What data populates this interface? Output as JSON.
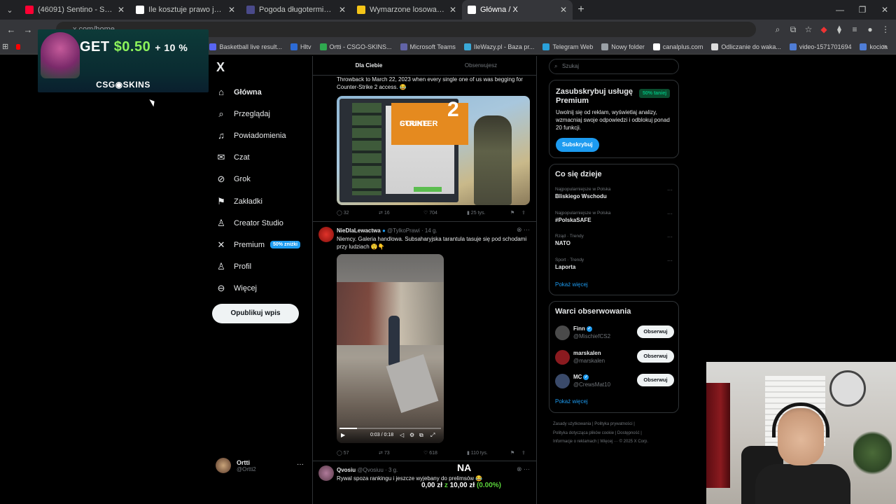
{
  "browser": {
    "tabs": [
      {
        "title": "(46091) Sentino - SAFE (Sila",
        "color": "#ff0033",
        "active": false
      },
      {
        "title": "Ile kosztuje prawo jazdy - Szuk",
        "color": "#ffffff",
        "active": false
      },
      {
        "title": "Pogoda długoterminowa Warsz",
        "color": "#4a4a8a",
        "active": false
      },
      {
        "title": "Wymarzone losowanie Barcelon",
        "color": "#f5c518",
        "active": false
      },
      {
        "title": "Główna / X",
        "color": "#ffffff",
        "active": true
      }
    ],
    "address": "x.com/home",
    "bookmarks": [
      {
        "label": "Basketball live result...",
        "color": "#5865f2"
      },
      {
        "label": "Hltv",
        "color": "#2c6bd6"
      },
      {
        "label": "Ortti - CSGO-SKINS...",
        "color": "#2fa84f"
      },
      {
        "label": "Microsoft Teams",
        "color": "#6264a7"
      },
      {
        "label": "IleWazy.pl - Baza pr...",
        "color": "#3aa9d8"
      },
      {
        "label": "Telegram Web",
        "color": "#2aa1da"
      },
      {
        "label": "Nowy folder",
        "color": "#9aa0a6"
      },
      {
        "label": "canalplus.com",
        "color": "#ffffff"
      },
      {
        "label": "Odliczanie do waka...",
        "color": "#dddddd"
      },
      {
        "label": "video-1571701694",
        "color": "#4f7dd6"
      },
      {
        "label": "kocica",
        "color": "#4f7dd6"
      }
    ]
  },
  "ad": {
    "get": "GET",
    "amount": "$0.50",
    "plus": "+ 10 %",
    "brand": "CSG◉SKINS"
  },
  "sidebar": {
    "logo": "X",
    "items": [
      {
        "label": "Główna",
        "icon": "home-icon",
        "glyph": "⌂"
      },
      {
        "label": "Przeglądaj",
        "icon": "search-icon",
        "glyph": "⌕"
      },
      {
        "label": "Powiadomienia",
        "icon": "bell-icon",
        "glyph": "♫"
      },
      {
        "label": "Czat",
        "icon": "mail-icon",
        "glyph": "✉"
      },
      {
        "label": "Grok",
        "icon": "grok-icon",
        "glyph": "⊘"
      },
      {
        "label": "Zakładki",
        "icon": "bookmark-icon",
        "glyph": "⚑"
      },
      {
        "label": "Creator Studio",
        "icon": "creator-icon",
        "glyph": "♙"
      },
      {
        "label": "Premium",
        "icon": "x-icon",
        "glyph": "✕",
        "badge": "50% zniżki"
      },
      {
        "label": "Profil",
        "icon": "profile-icon",
        "glyph": "♙"
      },
      {
        "label": "Więcej",
        "icon": "more-icon",
        "glyph": "⊖"
      }
    ],
    "post_button": "Opublikuj wpis",
    "profile": {
      "name": "Ortti",
      "handle": "@Ortti2"
    }
  },
  "feed": {
    "tabs": [
      "Dla Ciebie",
      "Obserwujesz"
    ],
    "tweet1": {
      "text": "Throwback to March 22, 2023 when every single one of us was begging for Counter-Strike 2 access. 😂",
      "image_title_1": "COUNTER",
      "image_title_2": "STRIKE",
      "image_num": "2",
      "replies": "32",
      "retweets": "16",
      "likes": "704",
      "views": "25 tys."
    },
    "tweet2": {
      "author": "NieDlaLewactwa",
      "handle": "@TylkoPrawi · 14 g.",
      "text": "Niemcy. Galeria handlowa. Subsaharyjska tarantula tasuje się pod schodami przy ludziach 😲👇",
      "video_time": "0:03 / 0:18",
      "video_progress": 0.17,
      "replies": "57",
      "retweets": "73",
      "likes": "618",
      "views": "110 tys."
    },
    "tweet3": {
      "author": "Qvosiu",
      "handle": "@Qvosiuu · 3 g.",
      "text": "Rywal spoza rankingu i jeszcze wyjebany do prelimsów 😂"
    }
  },
  "right": {
    "search_placeholder": "Szukaj",
    "premium": {
      "title": "Zasubskrybuj usługę Premium",
      "badge": "50% taniej",
      "text": "Uwolnij się od reklam, wyświetlaj analizy, wzmacniaj swoje odpowiedzi i odblokuj ponad 20 funkcji.",
      "button": "Subskrybuj"
    },
    "trends": {
      "title": "Co się dzieje",
      "items": [
        {
          "meta": "Najpopularniejsze w Polska",
          "name": "Bliskiego Wschodu"
        },
        {
          "meta": "Najpopularniejsze w Polska",
          "name": "#PolskaSAFE"
        },
        {
          "meta": "Rząd · Trendy",
          "name": "NATO"
        },
        {
          "meta": "Sport · Trendy",
          "name": "Laporta"
        }
      ],
      "more": "Pokaż więcej"
    },
    "follow": {
      "title": "Warci obserwowania",
      "items": [
        {
          "name": "Finn",
          "handle": "@MischiefCS2",
          "button": "Obserwuj",
          "verified": true,
          "color": "#4a4a4a"
        },
        {
          "name": "marskalen",
          "handle": "@marskalen",
          "button": "Obserwuj",
          "verified": false,
          "color": "#8a1a1f"
        },
        {
          "name": "MC",
          "handle": "@CrewsMat10",
          "button": "Obserwuj",
          "verified": true,
          "color": "#3a4a6a"
        }
      ],
      "more": "Pokaż więcej"
    },
    "footer": [
      "Zasady użytkowania  |  Polityka prywatności  |",
      "Polityka dotycząca plików cookie  |  Dostępność  |",
      "Informacje o reklamach  |  Więcej ···  © 2025 X Corp."
    ]
  },
  "overlay": {
    "label": "NA",
    "stats_prefix": "0,00 zł",
    "stats_mid": "z",
    "stats_total": "10,00 zł",
    "stats_pct": "(0.00%)"
  }
}
